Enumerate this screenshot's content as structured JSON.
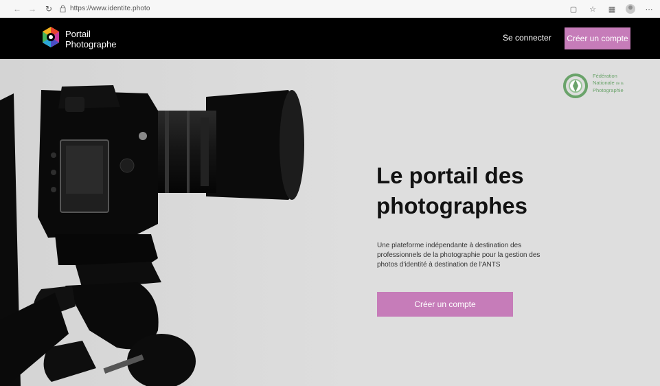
{
  "browser": {
    "url": "https://www.identite.photo",
    "icons": [
      "back-icon",
      "forward-icon",
      "reload-icon",
      "lock-icon",
      "reader-mode-icon",
      "favorites-icon",
      "collections-icon",
      "profile-icon",
      "more-icon"
    ]
  },
  "header": {
    "brand_line1": "Portail",
    "brand_line2": "Photographe",
    "login_label": "Se connecter",
    "signup_label": "Créer un compte"
  },
  "partner": {
    "line1": "Fédération",
    "line2": "Nationale",
    "line2_small": "de la",
    "line3": "Photographie"
  },
  "hero": {
    "title_line1": "Le portail des",
    "title_line2": "photographes",
    "description": "Une plateforme indépendante à destination des professionnels de la photographie pour la gestion des photos d'identité à destination de l'ANTS",
    "cta_label": "Créer un compte"
  },
  "colors": {
    "accent": "#c67cb9",
    "header_bg": "#000000",
    "hero_bg": "#dedede",
    "partner_green": "#6aa36a"
  }
}
